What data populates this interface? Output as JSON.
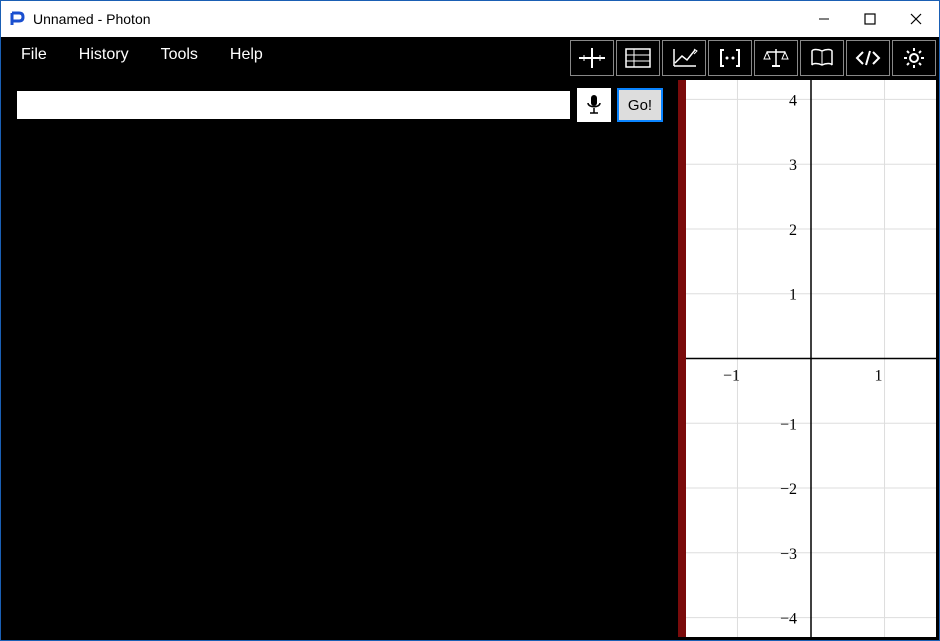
{
  "window": {
    "title": "Unnamed - Photon"
  },
  "menu": {
    "items": [
      "File",
      "History",
      "Tools",
      "Help"
    ]
  },
  "toolbar": {
    "icons": [
      "axes-icon",
      "table-icon",
      "plot-icon",
      "brackets-icon",
      "scales-icon",
      "book-icon",
      "code-icon",
      "gear-icon"
    ]
  },
  "input": {
    "expression": "",
    "go_label": "Go!"
  },
  "chart_data": {
    "type": "cartesian-grid",
    "xlim": [
      -1.7,
      1.7
    ],
    "ylim": [
      -4.3,
      4.3
    ],
    "x_ticks": [
      -1,
      1
    ],
    "y_ticks": [
      -4,
      -3,
      -2,
      -1,
      1,
      2,
      3,
      4
    ],
    "x_axis_visible": true,
    "y_axis_visible": true,
    "grid": true,
    "series": []
  }
}
